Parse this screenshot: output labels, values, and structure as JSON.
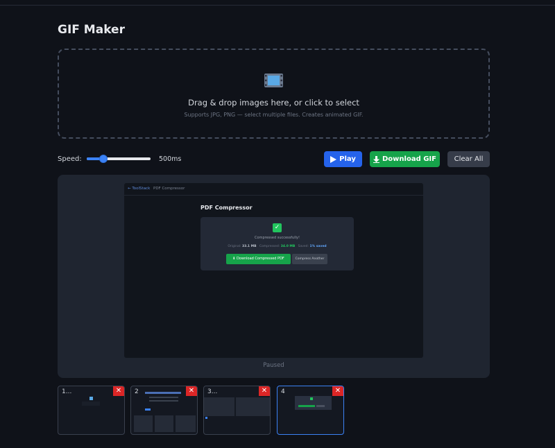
{
  "page": {
    "title": "GIF Maker"
  },
  "dropzone": {
    "icon": "film-icon",
    "text": "Drag & drop images here, or click to select",
    "subtext": "Supports JPG, PNG — select multiple files. Creates animated GIF."
  },
  "controls": {
    "speed_label": "Speed:",
    "speed_value": "500ms",
    "speed_fraction": 0.22,
    "play_icon": "play-icon",
    "play_label": "Play",
    "download_icon": "download-icon",
    "download_label": "Download GIF",
    "clear_label": "Clear All"
  },
  "preview": {
    "status": "Paused",
    "frame": {
      "nav_logo": "← ToolStack",
      "nav_title": "PDF Compressor",
      "heading": "PDF Compressor",
      "success_icon": "check-icon",
      "message": "Compressed successfully!",
      "stats": {
        "original_label": "Original:",
        "original_value": "33.1 MB",
        "compressed_label": "Compressed:",
        "compressed_value": "34.0 MB",
        "saved_label": "Saved:",
        "saved_value": "1% saved"
      },
      "download_button": "⬇ Download Compressed PDF",
      "another_button": "Compress Another"
    }
  },
  "thumbnails": [
    {
      "label": "1..."
    },
    {
      "label": "2"
    },
    {
      "label": "3..."
    },
    {
      "label": "4"
    }
  ],
  "colors": {
    "background": "#0f1219",
    "play": "#2563eb",
    "download": "#16a34a",
    "remove": "#dc2626",
    "accent": "#3b82f6"
  }
}
